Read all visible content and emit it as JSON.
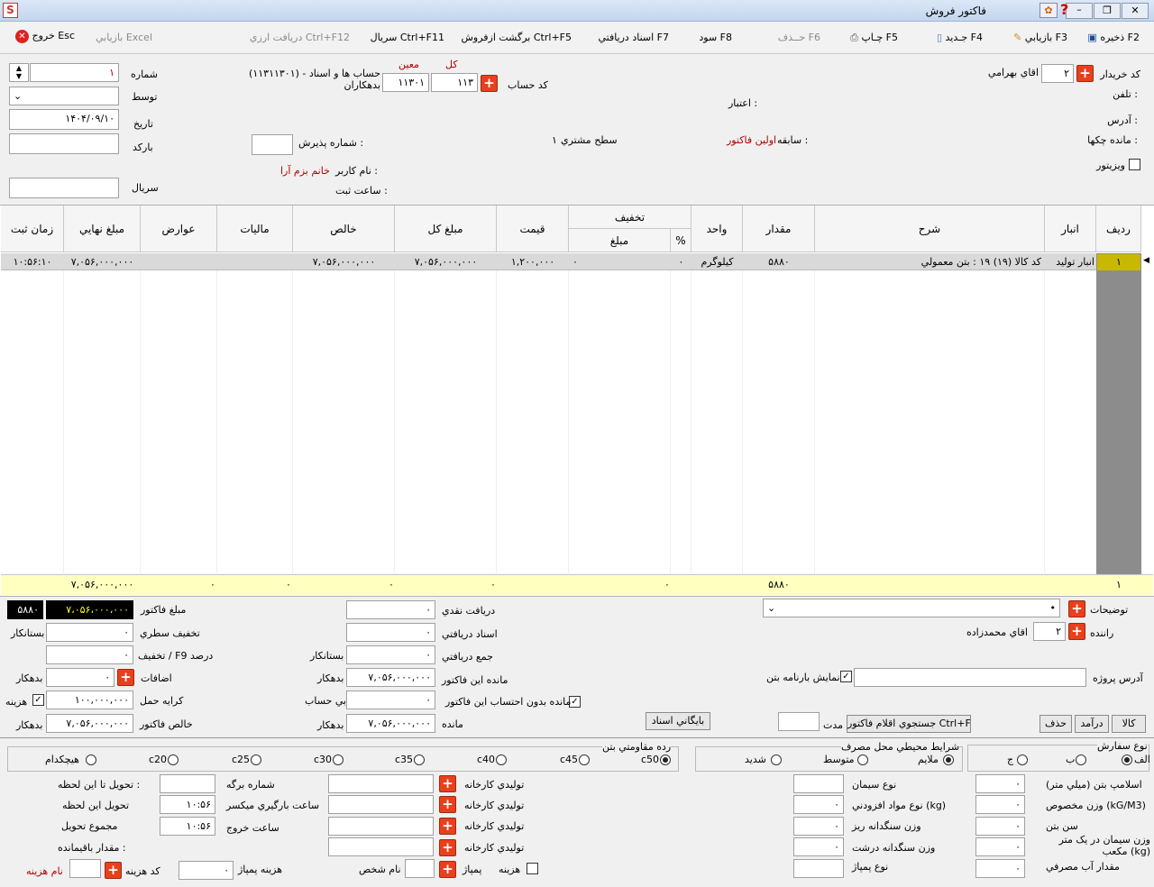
{
  "window": {
    "title": "فاکتور فروش",
    "min_icon": "minimize-icon",
    "max_icon": "maximize-icon",
    "close_icon": "close-icon"
  },
  "toolbar": {
    "save": "ذخیره F2",
    "retrieve": "بازيابي F3",
    "new": "جـديد F4",
    "print": "چـاپ F5",
    "delete": "حــذف F6",
    "profit": "سود F8",
    "received_docs": "اسناد دريافتي F7",
    "return_sale": "برگشت ازفروش Ctrl+F5",
    "serial": "سريال Ctrl+F11",
    "fx_receive": "دريافت ارزي Ctrl+F12",
    "excel": "بازيابي Excel",
    "exit": "خروج Esc"
  },
  "header": {
    "buyer_code_label": "کد خريدار",
    "buyer_code": "۲",
    "buyer_name": "اقاي بهرامي",
    "phone_label": "تلفن :",
    "address_label": "آدرس :",
    "checks_label": "مانده چکها :",
    "visitor_label": "ويزيتور",
    "account_code_label": "کد حساب",
    "kol_label": "کل",
    "moin_label": "معين",
    "kol_value": "۱۱۳",
    "moin_value": "۱۱۳۰۱",
    "account_desc": "(۱۱۳۱۱۳۰۱) حساب ها و اسناد - بدهکاران",
    "credit_label": "اعتبار :",
    "history_label": "سابقه :",
    "history_value": "اولين فاکتور",
    "level_label": "سطح مشتري",
    "level_value": "۱",
    "accept_no_label": "شماره پذيرش :",
    "username_label": "نام کاربر :",
    "username_value": "خانم بزم آرا",
    "regtime_label": "ساعت ثبت :",
    "number_label": "شماره",
    "number_value": "۱",
    "by_label": "توسط",
    "date_label": "تاريخ",
    "date_value": "۱۴۰۴/۰۹/۱۰",
    "barcode_label": "بارکد",
    "serial_label": "سريال"
  },
  "table": {
    "headers": {
      "row": "رديف",
      "warehouse": "انبار",
      "desc": "شرح",
      "qty": "مقدار",
      "unit": "واحد",
      "discount": "تخفيف",
      "disc_pct": "%",
      "disc_amt": "مبلغ",
      "price": "قيمت",
      "total": "مبلغ کل",
      "net": "خالص",
      "tax": "ماليات",
      "duties": "عوارض",
      "final": "مبلغ نهايي",
      "regtime": "زمان ثبت"
    },
    "rows": [
      {
        "row": "۱",
        "warehouse": "انبار توليد",
        "desc": "کد کالا (۱۹) ۱۹ : بتن معمولي",
        "qty": "۵۸۸۰",
        "unit": "کيلوگرم",
        "disc_pct": "۰",
        "disc_amt": "۰",
        "price": "۱,۲۰۰,۰۰۰",
        "total": "۷,۰۵۶,۰۰۰,۰۰۰",
        "net": "۷,۰۵۶,۰۰۰,۰۰۰",
        "tax": "",
        "duties": "",
        "final": "۷,۰۵۶,۰۰۰,۰۰۰",
        "regtime": "۱۰:۵۶:۱۰"
      }
    ],
    "footer": {
      "row": "۱",
      "qty": "۵۸۸۰",
      "disc_amt": "۰",
      "total": "۰",
      "net": "۰",
      "tax": "۰",
      "duties": "۰",
      "final": "۷,۰۵۶,۰۰۰,۰۰۰"
    }
  },
  "summary": {
    "invoice_amount_label": "مبلغ فاکتور",
    "invoice_amount": "۷،۰۵۶،۰۰۰،۰۰۰",
    "qty_box": "۵۸۸۰",
    "row_discount_label": "تخفيف سطري",
    "row_discount": "۰",
    "creditor": "بستانکار",
    "pct_discount_label": "تخفيف / F9 درصد",
    "pct_discount": "۰",
    "additions_label": "اضافات",
    "additions": "۰",
    "debtor": "بدهکار",
    "freight_label": "کرايه حمل",
    "freight": "۱۰۰,۰۰۰,۰۰۰",
    "cost_label": "هزينه",
    "net_invoice_label": "خالص فاکتور",
    "net_invoice": "۷,۰۵۶,۰۰۰,۰۰۰",
    "cash_label": "دريافت نقدي",
    "cash": "۰",
    "recv_docs_label": "اسناد دريافتي",
    "recv_docs": "۰",
    "total_recv_label": "جمع دريافتي",
    "total_recv": "۰",
    "remain_label": "مانده اين فاکتور",
    "remain": "۷,۰۵۶,۰۰۰,۰۰۰",
    "noaccount_label": "بي حساب",
    "noaccount": "۰",
    "remain_wo_label": "مانده بدون احتساب اين فاکتور",
    "balance_label": "مانده",
    "balance": "۷,۰۵۶,۰۰۰,۰۰۰",
    "archive_button": "بايگاني اسناد",
    "notes_label": "توضيحات",
    "driver_label": "راننده",
    "driver_code": "۲",
    "driver_name": "اقاي محمدزاده",
    "project_addr_label": "آدرس پروژه",
    "show_waybill_label": "نمايش بارنامه بتن",
    "search_button": "جستجوي اقلام فاکتور Ctrl+F",
    "duration_label": "مدت",
    "goods_button": "کالا",
    "income_button": "درآمد",
    "delete_button": "حذف"
  },
  "options": {
    "order_type_label": "نوع سفارش",
    "order_types": [
      "الف",
      "ب",
      "ج"
    ],
    "env_label": "شرايط محيطي محل مصرف",
    "env": [
      "ملايم",
      "متوسط",
      "شديد"
    ],
    "strength_label": "رده مقاومتي بتن",
    "strengths": [
      "c50",
      "c45",
      "c40",
      "c35",
      "c30",
      "c25",
      "c20",
      "هيچکدام"
    ]
  },
  "bottom": {
    "slump": "اسلامپ بتن (ميلي متر)",
    "slump_v": "۰",
    "specweight": "وزن مخصوص (kG/M3)",
    "specweight_v": "۰",
    "age": "سن بتن",
    "age_v": "۰",
    "cement_weight": "وزن سيمان در يک متر مکعب (kg)",
    "cement_weight_v": "۰",
    "water": "مقدار آب مصرفي",
    "water_v": "۰",
    "cement_type": "نوع سيمان",
    "additive": "نوع مواد افزودني  (kg)",
    "additive_v": "۰",
    "fine_agg": "وزن سنگدانه ريز",
    "fine_agg_v": "۰",
    "coarse_agg": "وزن سنگدانه درشت",
    "coarse_agg_v": "۰",
    "pump_type": "نوع پمپاژ",
    "factory_prod": "توليدي کارخانه",
    "pump": "پمپاژ",
    "cost": "هزينه",
    "person": "نام شخص",
    "sheet_no": "شماره برگه",
    "mixer_time": "ساعت بارگيري ميکسر",
    "exit_time": "ساعت خروج",
    "pump_cost": "هزينه پمپاژ",
    "pump_cost_v": "۰",
    "mixer_time_v": "۱۰:۵۶",
    "exit_time_v": "۱۰:۵۶",
    "deliver_until": "تحويل تا اين لحظه :",
    "deliver_now": "تحويل اين لحظه",
    "deliver_total": "مجموع تحويل",
    "remaining": "مقدار باقيمانده :",
    "cost_code": "کد هزينه",
    "cost_name": "نام هزينه"
  },
  "colors": {
    "plus": "#e8401c",
    "footer": "#ffffc0",
    "selected_row": "#d9d9d9"
  }
}
